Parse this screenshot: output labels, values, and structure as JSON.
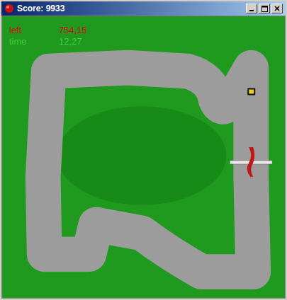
{
  "window": {
    "title": "Score: 9933"
  },
  "hud": [
    {
      "label": "left",
      "value": "754,15",
      "color": "#d01010"
    },
    {
      "label": "time",
      "value": "12,27",
      "color": "#3ccf3c"
    }
  ]
}
